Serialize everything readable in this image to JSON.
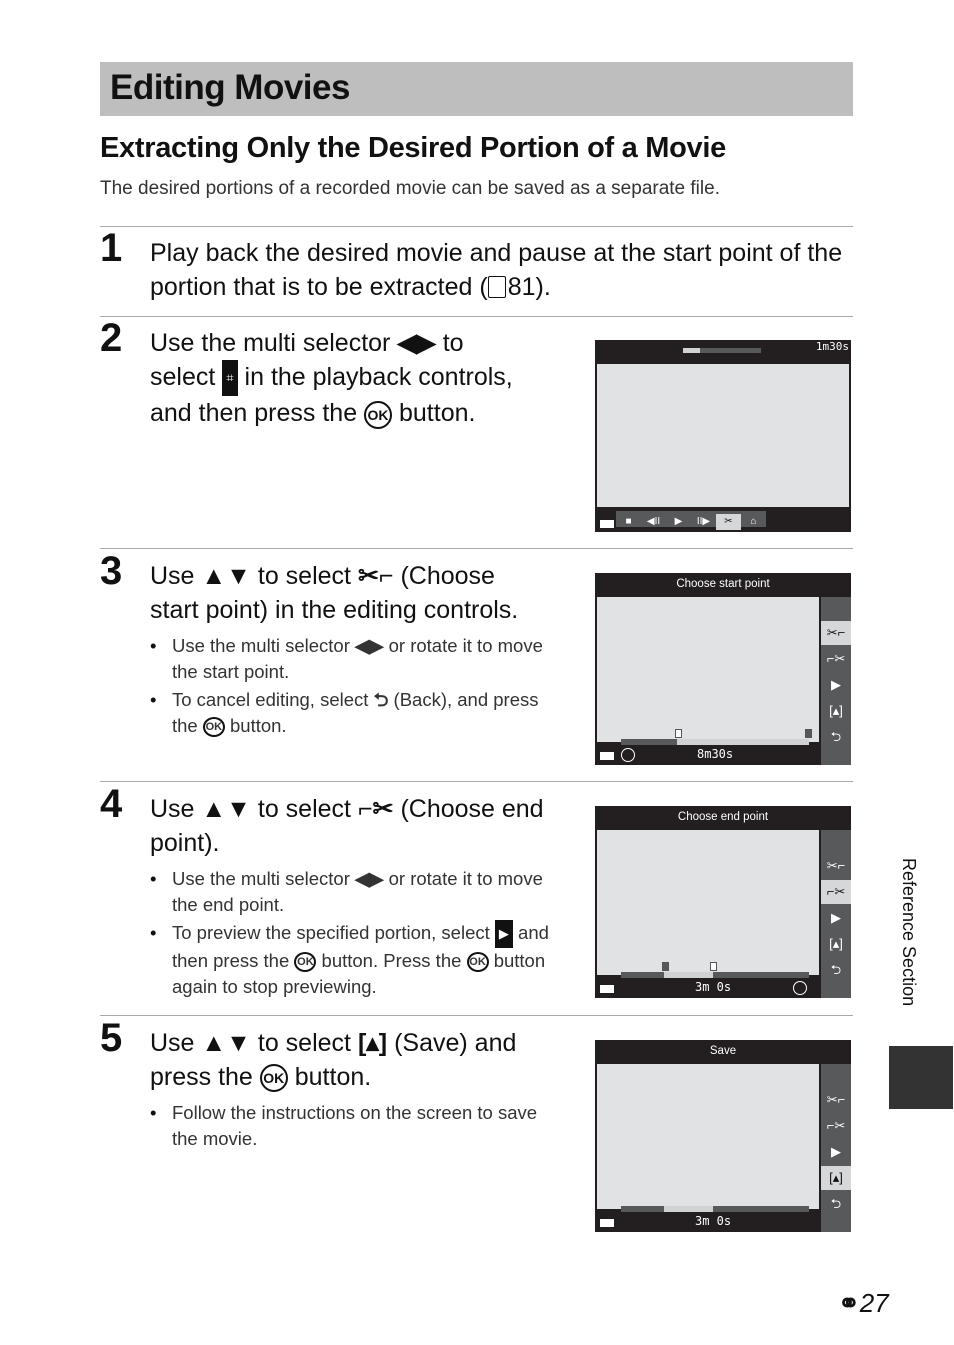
{
  "header": {
    "section_title": "Editing Movies",
    "subtitle": "Extracting Only the Desired Portion of a Movie",
    "intro": "The desired portions of a recorded movie can be saved as a separate file."
  },
  "steps": [
    {
      "number": "1",
      "text_a": "Play back the desired movie and pause at the start point of",
      "text_b": "the portion that is to be extracted (",
      "ref_icon": "book-reference-icon",
      "ref_page": "81",
      "text_c": ")."
    },
    {
      "number": "2",
      "line1_a": "Use the multi selector",
      "line1_icon": "◀▶",
      "line1_b": "to",
      "line2_a": "select",
      "line2_icon": "⌗",
      "line2_b": "in the playback controls,",
      "line3_a": "and then press the",
      "ok": "OK",
      "line3_b": "button."
    },
    {
      "number": "3",
      "line1_a": "Use",
      "arrows": "▲▼",
      "line1_b": "to select",
      "icon": "✂⌐",
      "line1_c": "(Choose",
      "line2": "start point) in the editing controls.",
      "bullets": [
        {
          "a": "Use the multi selector",
          "icon": "◀▶",
          "b": "or rotate it to move the start point."
        },
        {
          "a": "To cancel editing, select",
          "icon": "⮌",
          "b": "(Back), and press the",
          "ok": "OK",
          "c": "button."
        }
      ]
    },
    {
      "number": "4",
      "line1_a": "Use",
      "arrows": "▲▼",
      "line1_b": "to select",
      "icon": "⌐✂",
      "line1_c": "(Choose end",
      "line2": "point).",
      "bullets": [
        {
          "a": "Use the multi selector",
          "icon": "◀▶",
          "b": "or rotate it to move the end point."
        },
        {
          "a": "To preview the specified portion, select",
          "icon": "▶",
          "b": "and then press the",
          "ok": "OK",
          "c": "button. Press the",
          "d": "button again to stop previewing."
        }
      ]
    },
    {
      "number": "5",
      "line1_a": "Use",
      "arrows": "▲▼",
      "line1_b": "to select",
      "icon": "[▴]",
      "line1_c": "(Save) and",
      "line2_a": "press the",
      "ok": "OK",
      "line2_b": "button.",
      "bullets": [
        {
          "a": "Follow the instructions on the screen to save the movie."
        }
      ]
    }
  ],
  "screens": {
    "playback": {
      "time": "1m30s",
      "progress": 0.22,
      "controls": [
        "■",
        "◀II",
        "▶",
        "II▶",
        "✂",
        "⌂"
      ],
      "selected_index": 4
    },
    "start": {
      "header": "Choose start point",
      "time": "8m30s",
      "side": [
        "✂⌐",
        "⌐✂",
        "▶",
        "[▴]",
        "⮌"
      ],
      "selected_index": 0,
      "light_from": 0.3,
      "light_to": 1.0
    },
    "end": {
      "header": "Choose end point",
      "time": "3m  0s",
      "side": [
        "✂⌐",
        "⌐✂",
        "▶",
        "[▴]",
        "⮌"
      ],
      "selected_index": 1,
      "light_from": 0.23,
      "light_to": 0.49
    },
    "save": {
      "header": "Save",
      "time": "3m  0s",
      "side": [
        "✂⌐",
        "⌐✂",
        "▶",
        "[▴]",
        "⮌"
      ],
      "selected_index": 3,
      "light_from": 0.23,
      "light_to": 0.49
    }
  },
  "side_tab": {
    "label": "Reference Section"
  },
  "footer": {
    "page_prefix_icon": "binoculars-icon",
    "page_glyph": "⚭",
    "page_number": "27"
  }
}
